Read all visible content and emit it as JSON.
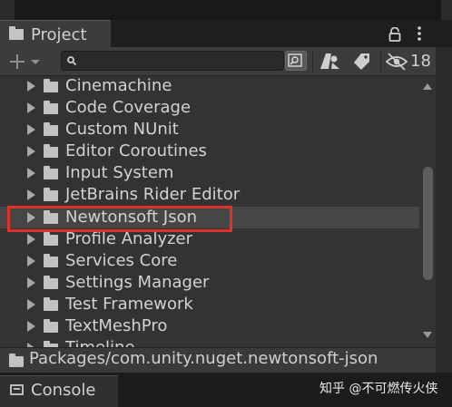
{
  "project_tab": {
    "label": "Project"
  },
  "toolbar": {
    "search_value": "",
    "hidden_packages_count": "18"
  },
  "tree": {
    "items": [
      {
        "label": "Cinemachine"
      },
      {
        "label": "Code Coverage"
      },
      {
        "label": "Custom NUnit"
      },
      {
        "label": "Editor Coroutines"
      },
      {
        "label": "Input System"
      },
      {
        "label": "JetBrains Rider Editor"
      },
      {
        "label": "Newtonsoft Json",
        "selected": true
      },
      {
        "label": "Profile Analyzer"
      },
      {
        "label": "Services Core"
      },
      {
        "label": "Settings Manager"
      },
      {
        "label": "Test Framework"
      },
      {
        "label": "TextMeshPro"
      },
      {
        "label": "Timeline"
      }
    ]
  },
  "path_bar": {
    "path": "Packages/com.unity.nuget.newtonsoft-json"
  },
  "console_tab": {
    "label": "Console"
  },
  "watermark": {
    "text": "知乎 @不可燃传火侠"
  },
  "colors": {
    "highlight": "#e0312b",
    "panel": "#333333",
    "selected_row": "#464646"
  },
  "icons": [
    "folder-icon",
    "lock-icon",
    "kebab-menu-icon",
    "plus-icon",
    "search-icon",
    "search-by-type-icon",
    "filter-type-icon",
    "label-tag-icon",
    "eye-hidden-icon",
    "console-icon"
  ]
}
